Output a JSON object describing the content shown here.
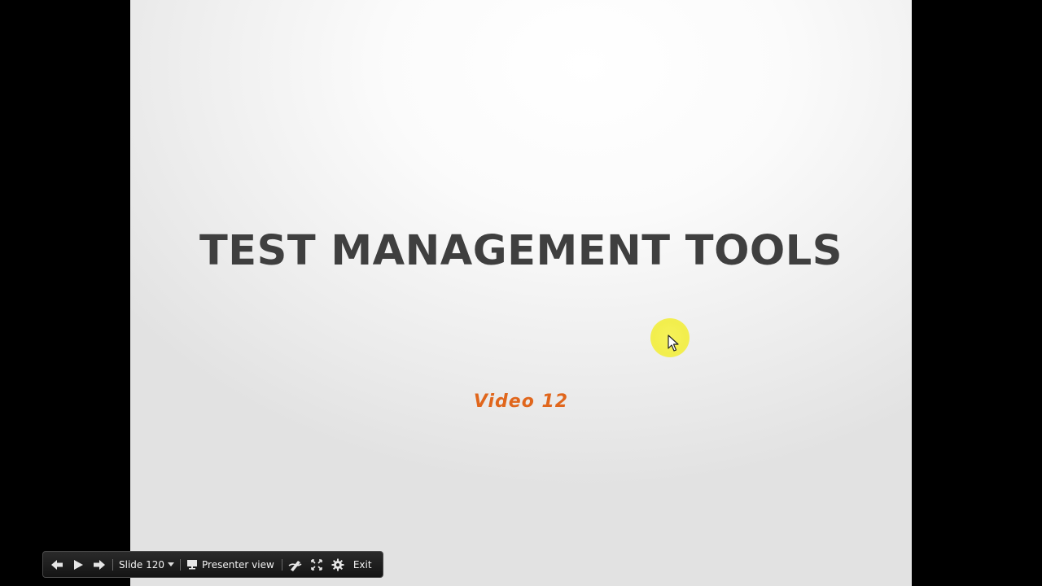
{
  "slide": {
    "title": "TEST MANAGEMENT TOOLS",
    "subtitle": "Video 12"
  },
  "toolbar": {
    "prev_icon": "arrow-left-icon",
    "play_icon": "play-icon",
    "next_icon": "arrow-right-icon",
    "slide_selector_label": "Slide 120",
    "presenter_view_label": "Presenter view",
    "pen_icon": "pen-icon",
    "fullscreen_icon": "fullscreen-icon",
    "settings_icon": "gear-icon",
    "exit_label": "Exit"
  },
  "colors": {
    "title": "#3f3f3f",
    "subtitle": "#e0661c",
    "cursor_highlight": "#f2ee4c",
    "toolbar_bg": "#1e1e1e"
  }
}
